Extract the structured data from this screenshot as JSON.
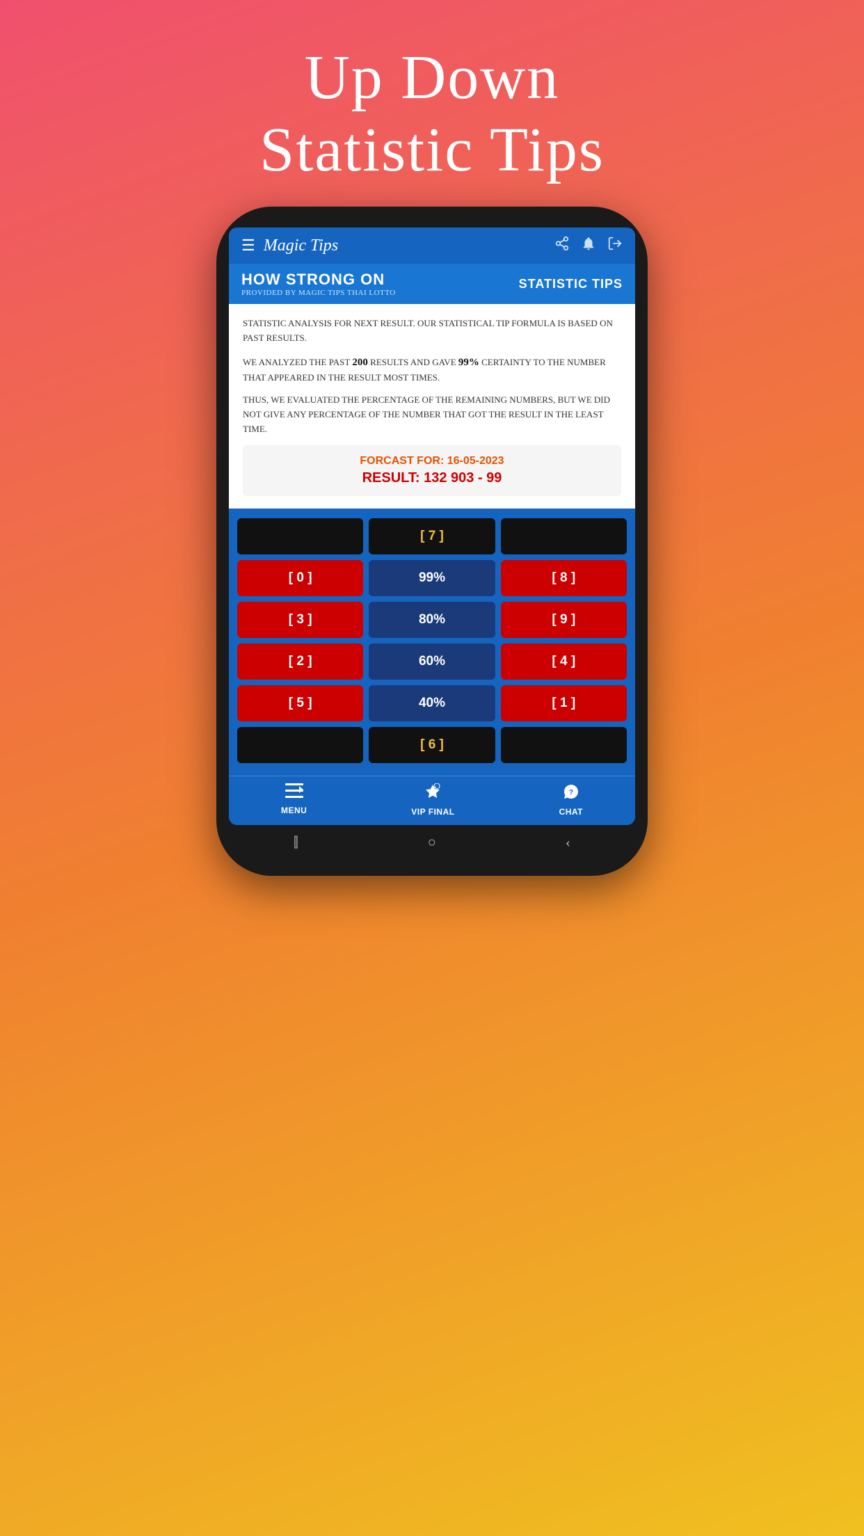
{
  "page": {
    "bg_title_line1": "Up Down",
    "bg_title_line2": "Statistic Tips"
  },
  "top_bar": {
    "brand": "Magic Tips",
    "icons": [
      "share",
      "bell",
      "exit"
    ]
  },
  "sub_header": {
    "title": "How strong on",
    "subtitle": "Provided by Magic tips thai lotto",
    "right_label": "Statistic Tips"
  },
  "content": {
    "para1": "Statistic analysis for next result. Our statistical tip formula is based on past results.",
    "para2": "We analyzed the past 200 results and gave 99% certainty to the number that appeared in the result most times.",
    "para3": "Thus, we evaluated the percentage of the remaining numbers, but we did not give any percentage of the number that got the result in the least time.",
    "forecast_label": "Forcast for:",
    "forecast_date": "16-05-2023",
    "forecast_result": "RESULT: 132 903 - 99"
  },
  "grid": {
    "rows": [
      [
        {
          "value": "",
          "type": "black"
        },
        {
          "value": "[ 7 ]",
          "type": "black"
        },
        {
          "value": "",
          "type": "black"
        }
      ],
      [
        {
          "value": "[ 0 ]",
          "type": "red"
        },
        {
          "value": "99%",
          "type": "blue"
        },
        {
          "value": "[ 8 ]",
          "type": "red"
        }
      ],
      [
        {
          "value": "[ 3 ]",
          "type": "red"
        },
        {
          "value": "80%",
          "type": "blue"
        },
        {
          "value": "[ 9 ]",
          "type": "red"
        }
      ],
      [
        {
          "value": "[ 2 ]",
          "type": "red"
        },
        {
          "value": "60%",
          "type": "blue"
        },
        {
          "value": "[ 4 ]",
          "type": "red"
        }
      ],
      [
        {
          "value": "[ 5 ]",
          "type": "red"
        },
        {
          "value": "40%",
          "type": "blue"
        },
        {
          "value": "[ 1 ]",
          "type": "red"
        }
      ],
      [
        {
          "value": "",
          "type": "black"
        },
        {
          "value": "[ 6 ]",
          "type": "black"
        },
        {
          "value": "",
          "type": "black"
        }
      ]
    ]
  },
  "bottom_nav": {
    "items": [
      {
        "label": "MENU",
        "icon": "☰"
      },
      {
        "label": "VIP FINAL",
        "icon": "★"
      },
      {
        "label": "CHAT",
        "icon": "?"
      }
    ]
  }
}
